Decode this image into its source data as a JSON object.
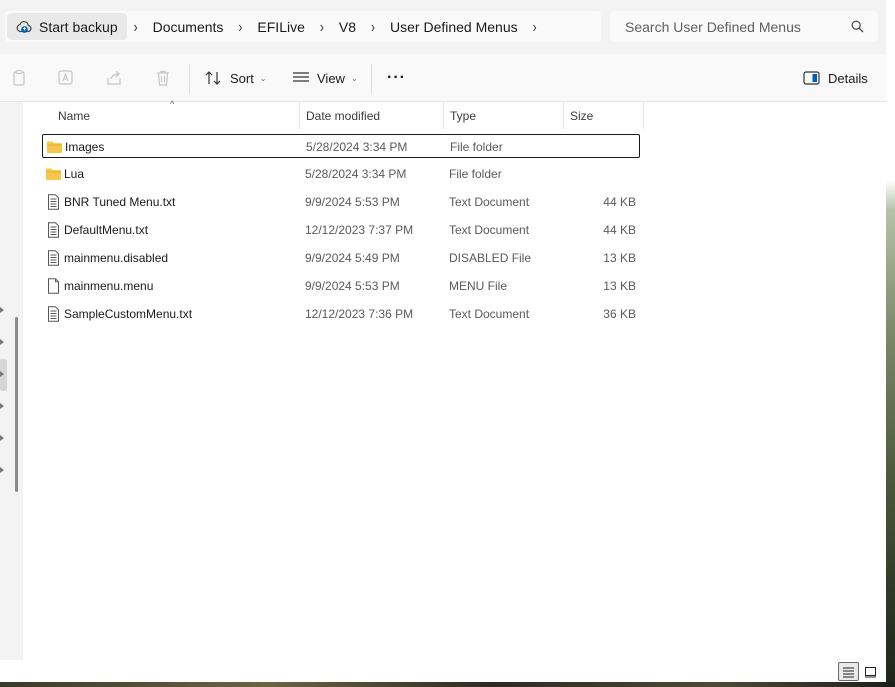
{
  "breadcrumb": {
    "root": "Start backup",
    "items": [
      "Documents",
      "EFILive",
      "V8",
      "User Defined Menus"
    ]
  },
  "search": {
    "placeholder": "Search User Defined Menus"
  },
  "toolbar": {
    "sort_label": "Sort",
    "view_label": "View",
    "more_label": "···",
    "details_label": "Details"
  },
  "columns": {
    "name": "Name",
    "date": "Date modified",
    "type": "Type",
    "size": "Size"
  },
  "files": [
    {
      "name": "Images",
      "date": "5/28/2024 3:34 PM",
      "type": "File folder",
      "size": "",
      "kind": "folder"
    },
    {
      "name": "Lua",
      "date": "5/28/2024 3:34 PM",
      "type": "File folder",
      "size": "",
      "kind": "folder"
    },
    {
      "name": "BNR Tuned Menu.txt",
      "date": "9/9/2024 5:53 PM",
      "type": "Text Document",
      "size": "44 KB",
      "kind": "text"
    },
    {
      "name": "DefaultMenu.txt",
      "date": "12/12/2023 7:37 PM",
      "type": "Text Document",
      "size": "44 KB",
      "kind": "text"
    },
    {
      "name": "mainmenu.disabled",
      "date": "9/9/2024 5:49 PM",
      "type": "DISABLED File",
      "size": "13 KB",
      "kind": "text"
    },
    {
      "name": "mainmenu.menu",
      "date": "9/9/2024 5:53 PM",
      "type": "MENU File",
      "size": "13 KB",
      "kind": "blank"
    },
    {
      "name": "SampleCustomMenu.txt",
      "date": "12/12/2023 7:36 PM",
      "type": "Text Document",
      "size": "36 KB",
      "kind": "text"
    }
  ],
  "icons": {
    "folder_color": "#f7c64a",
    "accent": "#005fb8"
  }
}
